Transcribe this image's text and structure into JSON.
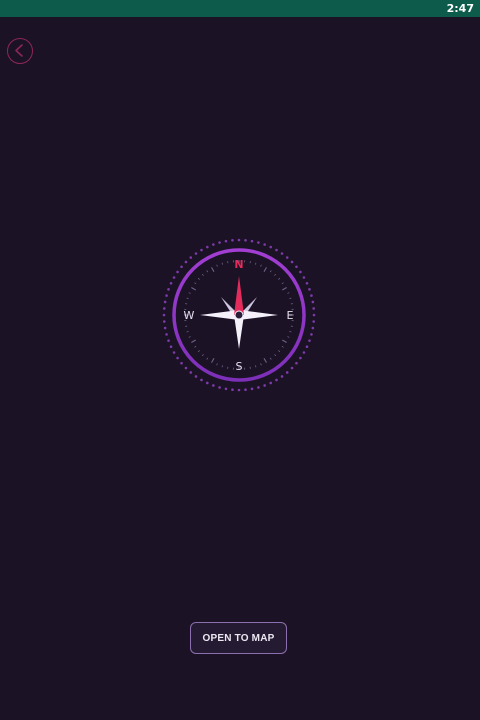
{
  "status_bar": {
    "time": "2:47",
    "color": "#0d5b4b"
  },
  "toolbar": {
    "back_icon": "chevron-left-icon",
    "accent": "#8d2657"
  },
  "compass": {
    "labels": {
      "north": "N",
      "east": "E",
      "south": "S",
      "west": "W"
    },
    "needle_color": "#e32c5b",
    "ring_color": "#9b3fd0"
  },
  "actions": {
    "open_map_label": "OPEN TO MAP"
  },
  "colors": {
    "background": "#1b1226",
    "button_border": "#8c6fae"
  }
}
